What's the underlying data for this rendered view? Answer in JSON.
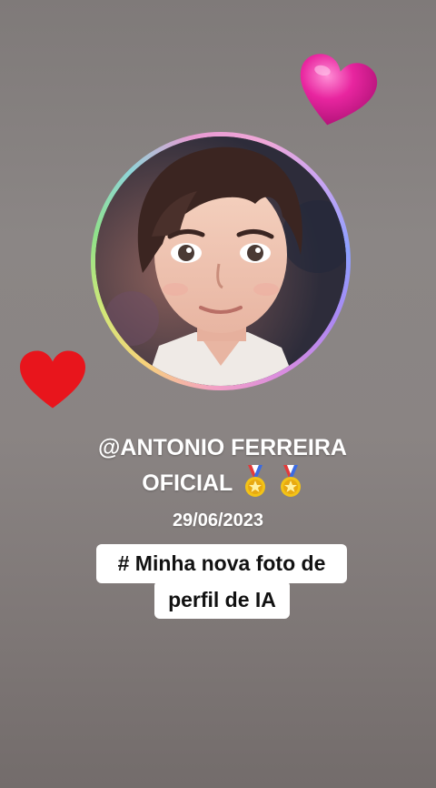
{
  "profile": {
    "username_line1": "@ANTONIO FERREIRA",
    "username_line2": "OFICIAL",
    "date": "29/06/2023",
    "badge_icons": [
      "medal-icon",
      "medal-icon"
    ]
  },
  "caption": {
    "line1": "# Minha nova foto de",
    "line2": "perfil de IA"
  },
  "decorations": {
    "hearts": [
      "pink-heart-icon",
      "red-heart-icon"
    ]
  },
  "colors": {
    "pink_heart": "#e0219a",
    "red_heart": "#e8151c",
    "caption_background": "#ffffff",
    "text": "#ffffff"
  }
}
